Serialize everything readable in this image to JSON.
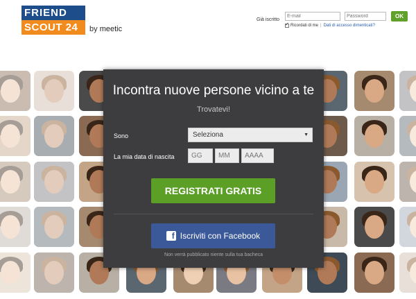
{
  "brand": {
    "logo_line1": "FRIEND",
    "logo_line2": "SCOUT 24",
    "byline_prefix": "by ",
    "byline_brand": "meetic",
    "colors": {
      "blue": "#1e4d8c",
      "orange": "#f28b1e"
    }
  },
  "login": {
    "label": "Già iscritto",
    "email_placeholder": "E-mail",
    "password_placeholder": "Password",
    "ok_label": "OK",
    "remember_label": "Ricordati di me",
    "separator": "|",
    "forgot_link": "Dati di accesso dimenticati?"
  },
  "signup": {
    "title": "Incontra nuove persone vicino a te",
    "subtitle": "Trovatevi!",
    "sono_label": "Sono",
    "sono_value": "Seleziona",
    "dob_label": "La mia data di nascita",
    "day_placeholder": "GG",
    "month_placeholder": "MM",
    "year_placeholder": "AAAA",
    "register_label": "REGISTRATI GRATIS",
    "facebook_label": "Iscriviti con Facebook",
    "facebook_note": "Non verrà pubblicato niente sulla tua bacheca",
    "colors": {
      "register": "#5c9f27",
      "facebook": "#3b5998",
      "panel": "#3d3d3f"
    }
  }
}
